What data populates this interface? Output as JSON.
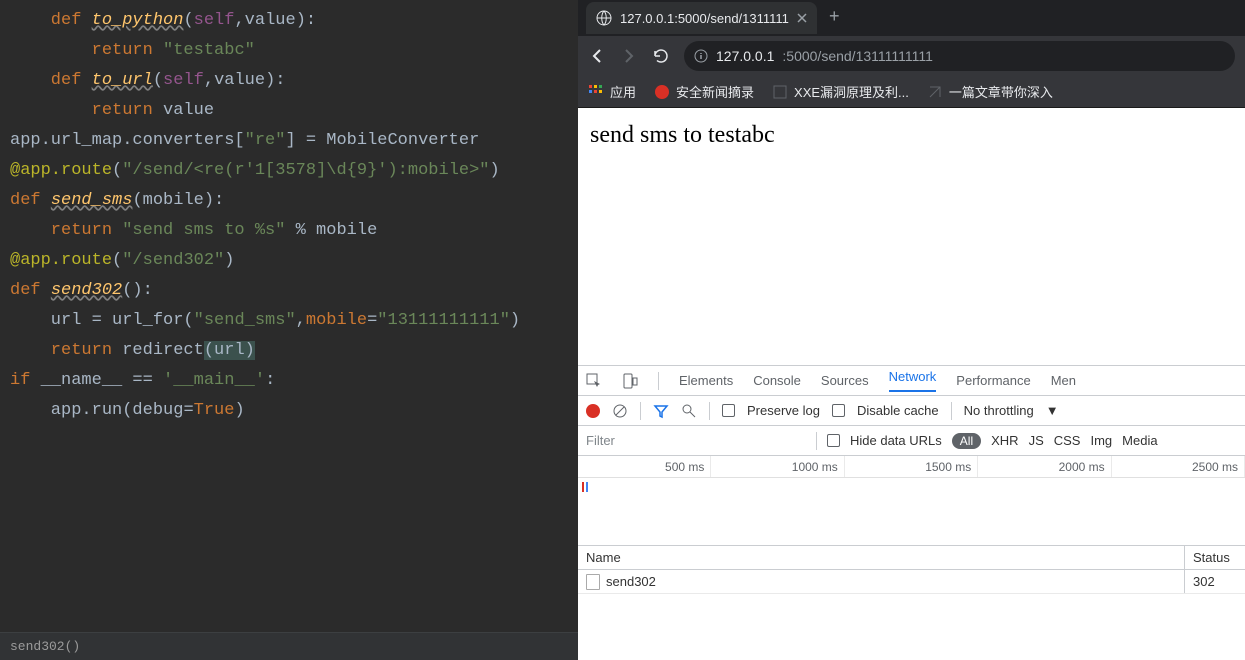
{
  "code": {
    "l1a": "    def ",
    "l1fn": "to_python",
    "l1b": "(",
    "l1self": "self",
    "l1c": ",",
    "l1p": "value",
    "l1d": "):",
    "l2a": "        return ",
    "l2s": "\"testabc\"",
    "l3a": "    def ",
    "l3fn": "to_url",
    "l3b": "(",
    "l3self": "self",
    "l3c": ",",
    "l3p": "value",
    "l3d": "):",
    "l4a": "        return ",
    "l4v": "value",
    "l5": "",
    "l6a": "app.url_map.converters[",
    "l6s": "\"re\"",
    "l6b": "] = MobileConverter",
    "l7": "",
    "l8a": "@app.route",
    "l8b": "(",
    "l8s": "\"/send/<re(r'1[3578]\\d{9}'):mobile>\"",
    "l8c": ")",
    "l9a": "def ",
    "l9fn": "send_sms",
    "l9b": "(",
    "l9p": "mobile",
    "l9c": "):",
    "l10a": "    return ",
    "l10s1": "\"send sms to %s\"",
    "l10b": " % mobile",
    "l11": "",
    "l12a": "@app.route",
    "l12b": "(",
    "l12s": "\"/send302\"",
    "l12c": ")",
    "l13a": "def ",
    "l13fn": "send302",
    "l13b": "():",
    "l14a": "    url = url_for(",
    "l14s": "\"send_sms\"",
    "l14b": ",",
    "l14p": "mobile",
    "l14c": "=",
    "l14s2": "\"13111111111\"",
    "l14d": ")",
    "l15a": "    return ",
    "l15b": "redirect",
    "l15c": "(url",
    "l15d": ")",
    "l16": "",
    "l17a": "if ",
    "l17b": "__name__ == ",
    "l17s": "'__main__'",
    "l17c": ":",
    "l18a": "    app.run(",
    "l18p": "debug",
    "l18b": "=",
    "l18v": "True",
    "l18c": ")"
  },
  "footer": {
    "breadcrumb": "send302()"
  },
  "browser": {
    "tab_title": "127.0.0.1:5000/send/1311111",
    "url_host": "127.0.0.1",
    "url_port_path": ":5000/send/13111111111",
    "bookmarks": {
      "apps": "应用",
      "b1": "安全新闻摘录",
      "b2": "XXE漏洞原理及利...",
      "b3": "一篇文章带你深入"
    },
    "page_text": "send sms to testabc"
  },
  "devtools": {
    "tabs": {
      "elements": "Elements",
      "console": "Console",
      "sources": "Sources",
      "network": "Network",
      "performance": "Performance",
      "mem": "Men"
    },
    "preserve": "Preserve log",
    "disable": "Disable cache",
    "throttle": "No throttling",
    "filter_ph": "Filter",
    "hide_urls": "Hide data URLs",
    "all": "All",
    "types": {
      "xhr": "XHR",
      "js": "JS",
      "css": "CSS",
      "img": "Img",
      "media": "Media"
    },
    "timeline": [
      "500 ms",
      "1000 ms",
      "1500 ms",
      "2000 ms",
      "2500 ms"
    ],
    "columns": {
      "name": "Name",
      "status": "Status"
    },
    "rows": [
      {
        "name": "send302",
        "status": "302"
      }
    ]
  }
}
